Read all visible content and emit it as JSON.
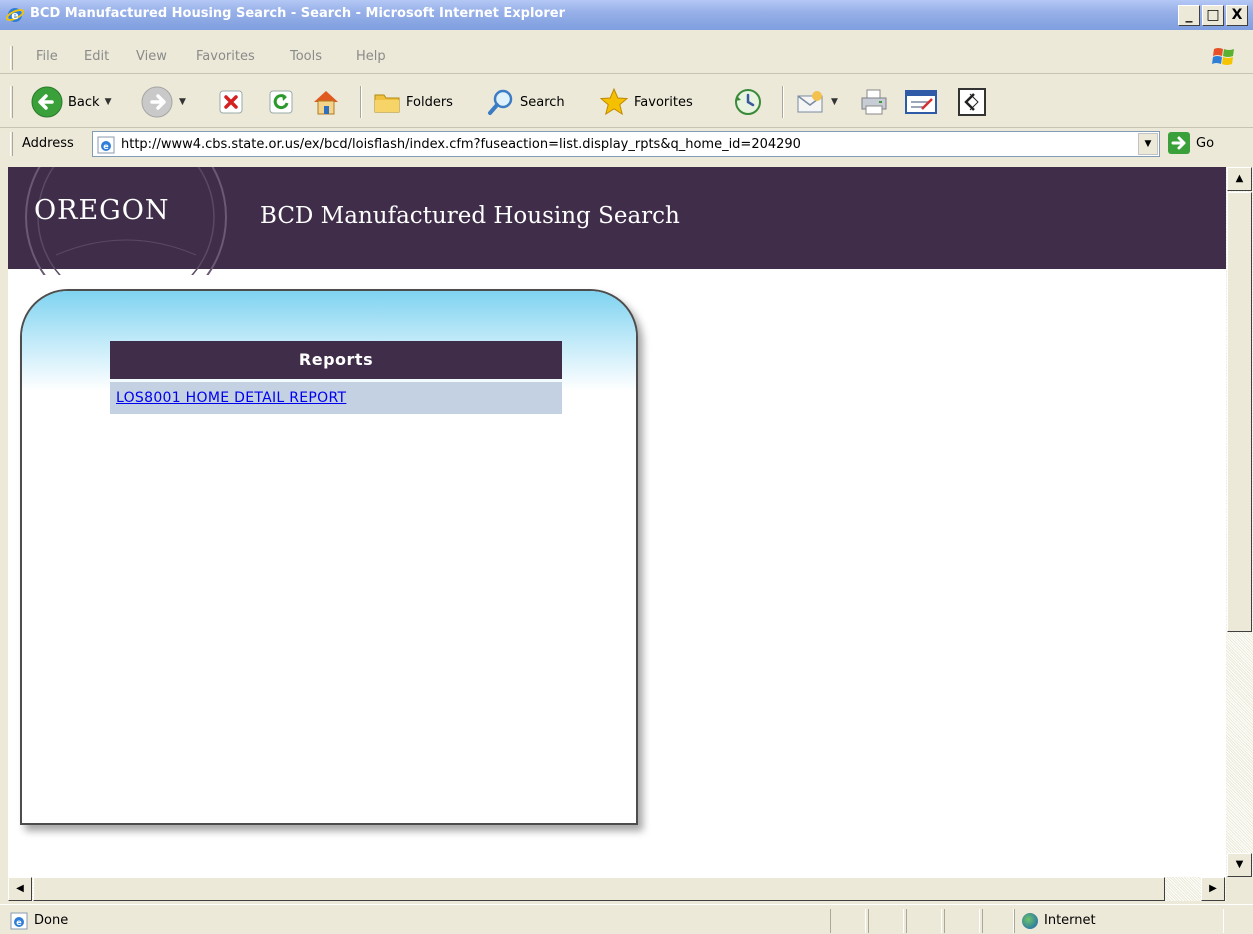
{
  "window": {
    "title": "BCD Manufactured Housing Search - Search - Microsoft Internet Explorer",
    "minimize": "_",
    "maximize": "□",
    "close": "X"
  },
  "menu": [
    "File",
    "Edit",
    "View",
    "Favorites",
    "Tools",
    "Help"
  ],
  "toolbar": {
    "back_label": "Back",
    "folders_label": "Folders",
    "search_label": "Search",
    "favorites_label": "Favorites"
  },
  "address": {
    "label": "Address",
    "url": "http://www4.cbs.state.or.us/ex/bcd/loisflash/index.cfm?fuseaction=list.display_rpts&q_home_id=204290",
    "go_label": "Go"
  },
  "page": {
    "oregon": "OREGON",
    "site_title": "BCD Manufactured Housing Search",
    "reports_header": "Reports",
    "reports": [
      {
        "label": "LOS8001 HOME DETAIL REPORT"
      }
    ]
  },
  "status": {
    "text": "Done",
    "zone": "Internet"
  },
  "colors": {
    "banner": "#3f2d4a",
    "report_row": "#c3d1e2",
    "link": "#0000ee"
  }
}
